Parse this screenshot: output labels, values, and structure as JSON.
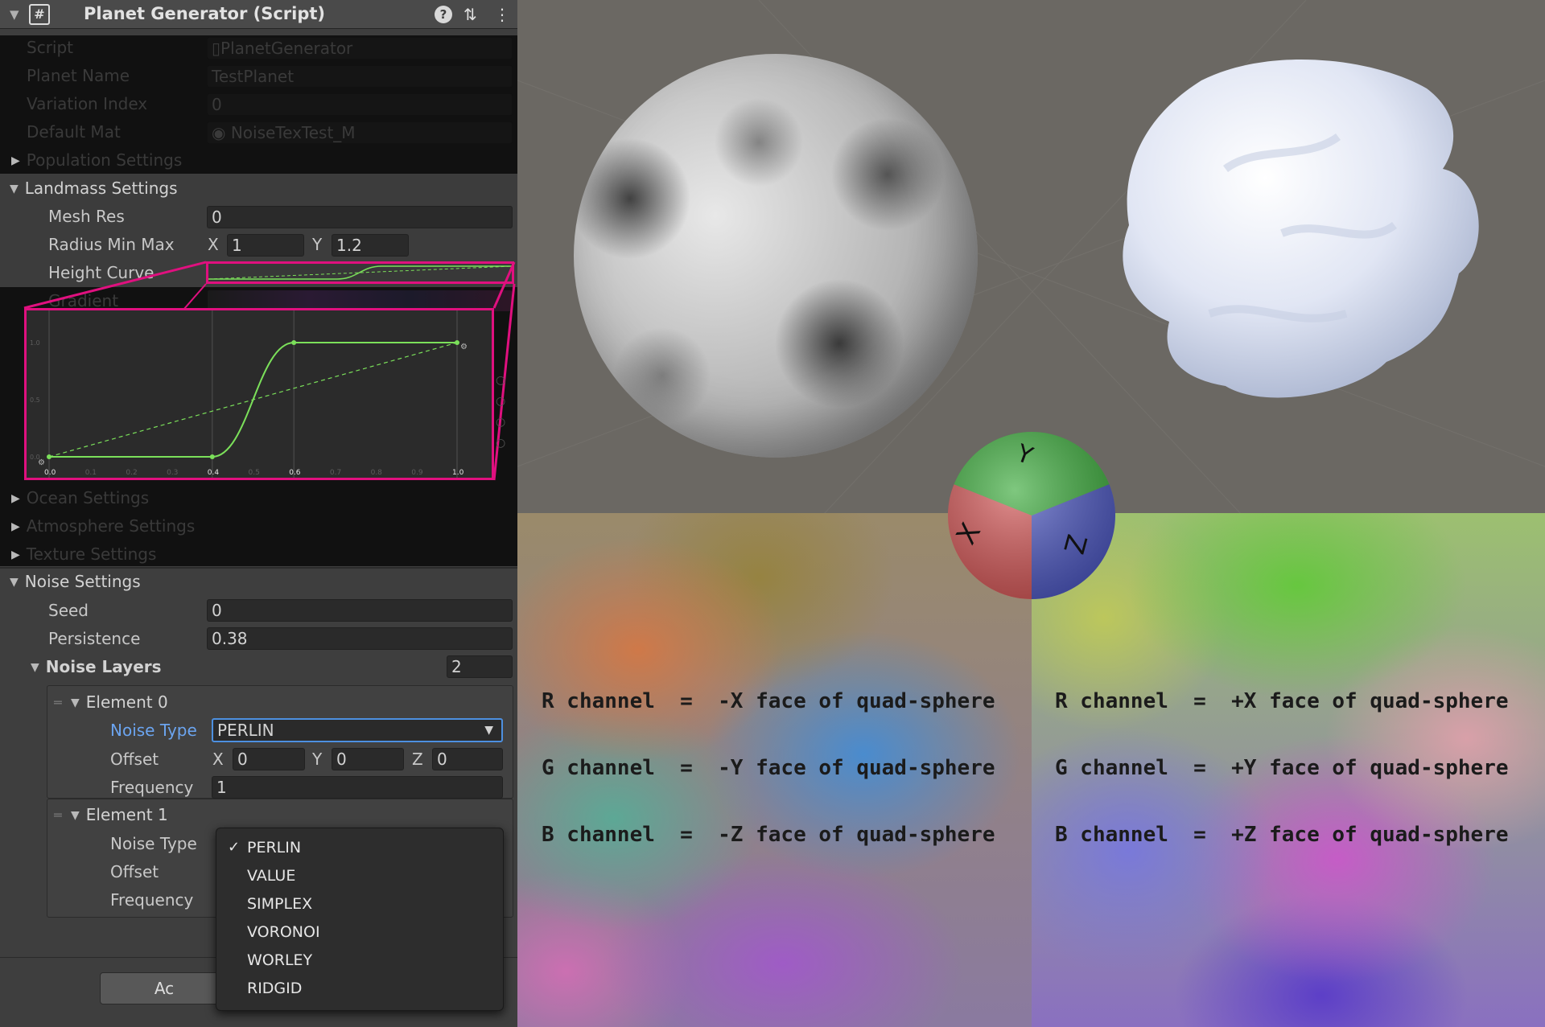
{
  "component": {
    "title": "Planet Generator (Script)",
    "help_icon": "?",
    "preset_icon": "⇅",
    "menu_icon": "⋮"
  },
  "fields": {
    "script_label": "Script",
    "script_value": "PlanetGenerator",
    "planet_name_label": "Planet Name",
    "planet_name_value": "TestPlanet",
    "variation_index_label": "Variation Index",
    "variation_index_value": "0",
    "default_mat_label": "Default Mat",
    "default_mat_value": "NoiseTexTest_M",
    "population_settings": "Population Settings",
    "landmass_settings": "Landmass Settings",
    "mesh_res_label": "Mesh Res",
    "mesh_res_value": "0",
    "radius_label": "Radius Min Max",
    "radius_x_label": "X",
    "radius_x_value": "1",
    "radius_y_label": "Y",
    "radius_y_value": "1.2",
    "height_curve_label": "Height Curve",
    "gradient_label": "Gradient",
    "ocean_settings": "Ocean Settings",
    "atmosphere_settings": "Atmosphere Settings",
    "texture_settings": "Texture Settings",
    "noise_settings": "Noise Settings",
    "seed_label": "Seed",
    "seed_value": "0",
    "persistence_label": "Persistence",
    "persistence_value": "0.38",
    "noise_layers_label": "Noise Layers",
    "noise_layers_count": "2"
  },
  "curve": {
    "x_ticks": [
      "0.0",
      "0.1",
      "0.2",
      "0.3",
      "0.4",
      "0.5",
      "0.6",
      "0.7",
      "0.8",
      "0.9",
      "1.0"
    ],
    "y_ticks": [
      "1.0",
      "0.5",
      "0.0"
    ],
    "keys": [
      [
        0.0,
        0.0
      ],
      [
        0.4,
        0.0
      ],
      [
        0.6,
        1.0
      ],
      [
        1.0,
        1.0
      ]
    ]
  },
  "elements": [
    {
      "title": "Element 0",
      "noise_type_label": "Noise Type",
      "noise_type_value": "PERLIN",
      "offset_label": "Offset",
      "offset_x_label": "X",
      "offset_x": "0",
      "offset_y_label": "Y",
      "offset_y": "0",
      "offset_z_label": "Z",
      "offset_z": "0",
      "frequency_label": "Frequency",
      "frequency_value": "1"
    },
    {
      "title": "Element 1",
      "noise_type_label": "Noise Type",
      "offset_label": "Offset",
      "frequency_label": "Frequency"
    }
  ],
  "dropdown": {
    "selected": "PERLIN",
    "options": [
      "PERLIN",
      "VALUE",
      "SIMPLEX",
      "VORONOI",
      "WORLEY",
      "RIDGID"
    ]
  },
  "add_button_label": "Ac",
  "channels_left": [
    "R channel  =  -X face of quad-sphere",
    "G channel  =  -Y face of quad-sphere",
    "B channel  =  -Z face of quad-sphere"
  ],
  "channels_right": [
    "R channel  =  +X face of quad-sphere",
    "G channel  =  +Y face of quad-sphere",
    "B channel  =  +Z face of quad-sphere"
  ],
  "gizmo": {
    "y_label": "Y",
    "x_label": "X",
    "z_label": "Z"
  },
  "colors": {
    "highlight_pink": "#e0107f",
    "curve_green": "#7be05a",
    "selected_blue": "#4d90e0"
  }
}
